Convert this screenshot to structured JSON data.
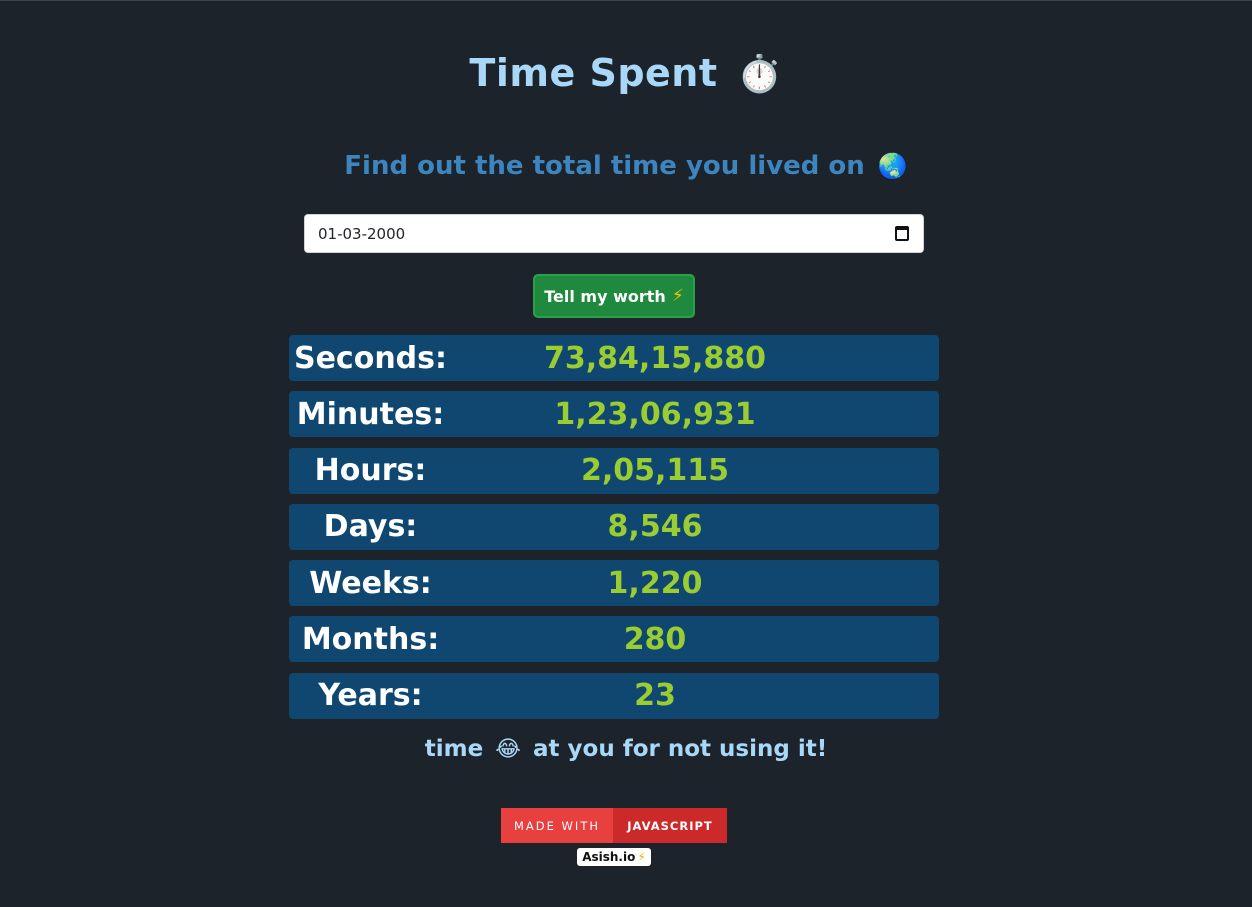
{
  "header": {
    "title": "Time Spent",
    "title_icon": "⏱️",
    "subtitle": "Find out the total time you lived on",
    "subtitle_icon": "🌏"
  },
  "form": {
    "date_value": "01-03-2000",
    "button_label": "Tell my worth",
    "button_icon": "⚡"
  },
  "stats": [
    {
      "label": "Seconds:",
      "value": "73,84,15,880"
    },
    {
      "label": "Minutes:",
      "value": "1,23,06,931"
    },
    {
      "label": "Hours:",
      "value": "2,05,115"
    },
    {
      "label": "Days:",
      "value": "8,546"
    },
    {
      "label": "Weeks:",
      "value": "1,220"
    },
    {
      "label": "Months:",
      "value": "280"
    },
    {
      "label": "Years:",
      "value": "23"
    }
  ],
  "footer": {
    "text_before": "time",
    "emoji": "😂",
    "text_after": "at you for not using it!",
    "badge_left": "MADE WITH",
    "badge_right": "JAVASCRIPT",
    "credit": "Asish.io",
    "credit_icon": "⚡"
  },
  "colors": {
    "background": "#1c232b",
    "title": "#a9d7f7",
    "subtitle": "#3d85bf",
    "row_bg": "#0f4770",
    "value": "#9acd32",
    "button": "#1f8a3d",
    "badge_left": "#e8403f",
    "badge_right": "#cc2a2a"
  }
}
